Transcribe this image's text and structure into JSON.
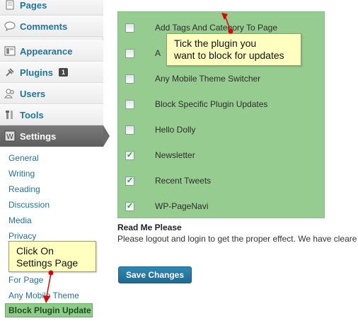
{
  "sidebar": {
    "menu": [
      {
        "label": "Pages",
        "icon": "pages-icon"
      },
      {
        "label": "Comments",
        "icon": "comments-icon"
      },
      {
        "label": "Appearance",
        "icon": "appearance-icon"
      },
      {
        "label": "Plugins",
        "icon": "plugins-icon",
        "badge": "1"
      },
      {
        "label": "Users",
        "icon": "users-icon"
      },
      {
        "label": "Tools",
        "icon": "tools-icon"
      }
    ],
    "settings": {
      "label": "Settings",
      "icon": "settings-icon"
    },
    "submenu": [
      "General",
      "Writing",
      "Reading",
      "Discussion",
      "Media",
      "Privacy",
      "For Page",
      "Any Mobile Theme"
    ],
    "current_submenu": "Block Plugin Update"
  },
  "plugins": [
    {
      "name": "Add Tags And Category To Page",
      "checked": false
    },
    {
      "name": "A",
      "checked": false
    },
    {
      "name": "Any Mobile Theme Switcher",
      "checked": false
    },
    {
      "name": "Block Specific Plugin Updates",
      "checked": false
    },
    {
      "name": "Hello Dolly",
      "checked": false
    },
    {
      "name": "Newsletter",
      "checked": true
    },
    {
      "name": "Recent Tweets",
      "checked": true
    },
    {
      "name": "WP-PageNavi",
      "checked": true
    }
  ],
  "readme": {
    "title": "Read Me Please",
    "text": "Please logout and login to get the proper effect. We have cleare"
  },
  "save_button": "Save Changes",
  "callouts": {
    "plugin_line1": "Tick the plugin you",
    "plugin_line2": "want to block for updates",
    "settings_line1": "Click On",
    "settings_line2": "Settings Page"
  },
  "colors": {
    "panel_bg": "#96cc8f",
    "callout_bg": "#ffffc0",
    "arrow_red": "#e00000",
    "link_blue": "#21759b"
  }
}
